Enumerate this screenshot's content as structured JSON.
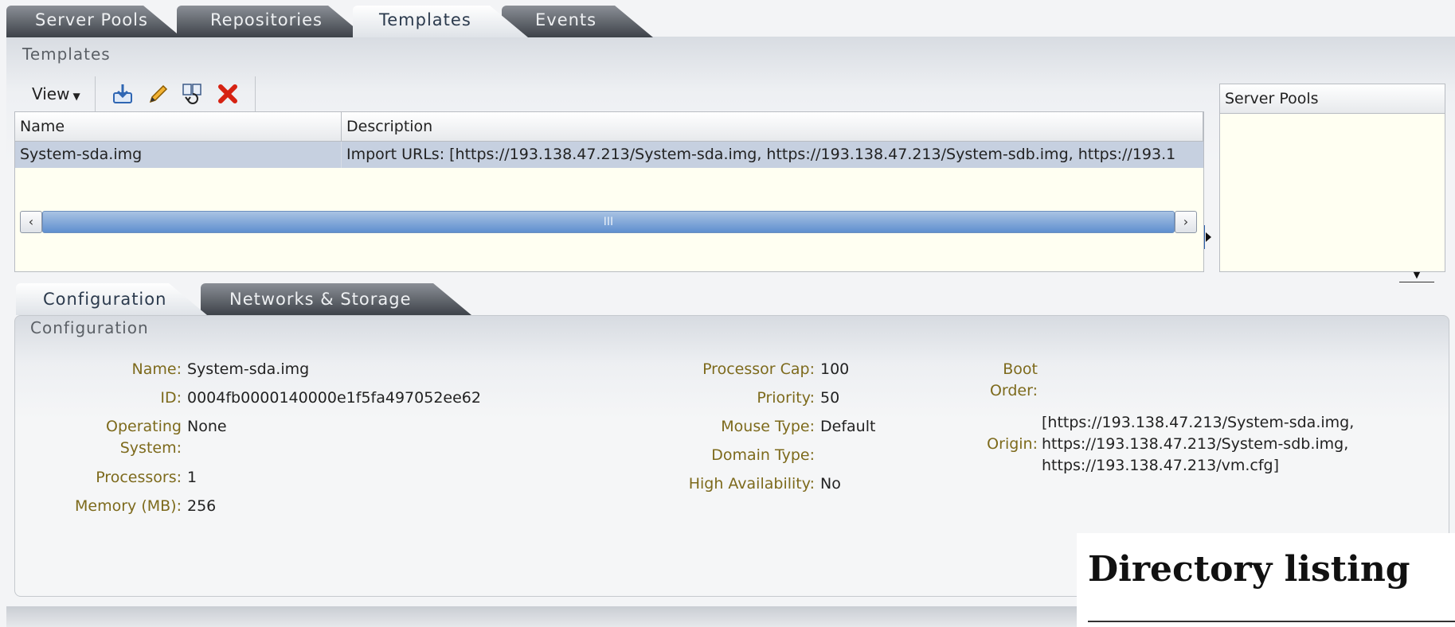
{
  "top_tabs": [
    "Server Pools",
    "Repositories",
    "Templates",
    "Events"
  ],
  "active_top_tab": "Templates",
  "templates_section_title": "Templates",
  "toolbar": {
    "view_label": "View",
    "icons": [
      "import-icon",
      "edit-icon",
      "clone-icon",
      "delete-icon"
    ]
  },
  "table": {
    "headers": [
      "Name",
      "Description"
    ],
    "rows": [
      {
        "name": "System-sda.img",
        "description": "Import URLs: [https://193.138.47.213/System-sda.img, https://193.138.47.213/System-sdb.img, https://193.1"
      }
    ],
    "scroll_grip": "III"
  },
  "server_pools_panel": {
    "header": "Server Pools"
  },
  "detail_tabs": [
    "Configuration",
    "Networks & Storage"
  ],
  "configuration": {
    "title": "Configuration",
    "left": [
      {
        "label": "Name:",
        "value": "System-sda.img"
      },
      {
        "label": "ID:",
        "value": "0004fb0000140000e1f5fa497052ee62"
      },
      {
        "label_line1": "Operating",
        "label_line2": "System:",
        "value": "None"
      },
      {
        "label": "Processors:",
        "value": "1"
      },
      {
        "label": "Memory (MB):",
        "value": "256"
      }
    ],
    "middle": [
      {
        "label": "Processor Cap:",
        "value": "100"
      },
      {
        "label": "Priority:",
        "value": "50"
      },
      {
        "label": "Mouse Type:",
        "value": "Default"
      },
      {
        "label": "Domain Type:",
        "value": ""
      },
      {
        "label": "High Availability:",
        "value": "No"
      }
    ],
    "right": {
      "boot_order_line1": "Boot",
      "boot_order_line2": "Order:",
      "origin_label": "Origin:",
      "origin_lines": [
        "[https://193.138.47.213/System-sda.img,",
        "https://193.138.47.213/System-sdb.img,",
        "https://193.138.47.213/vm.cfg]"
      ]
    }
  },
  "directory_overlay": {
    "title": "Directory listing"
  },
  "colors": {
    "tab_dark": "#3d4249",
    "row_selected": "#c6d0e0",
    "label_gold": "#7d6a1c",
    "scroll_blue": "#5f8fcf",
    "table_bg": "#fffff2"
  }
}
